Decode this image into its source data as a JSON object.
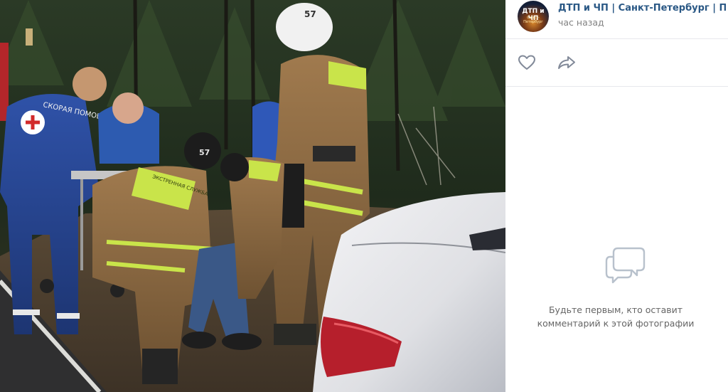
{
  "post": {
    "group_name": "ДТП и ЧП | Санкт-Петербург | Питер онлайн",
    "time": "час назад",
    "avatar_text": "ДТП и ЧП",
    "avatar_sub": "Санкт-Петербург"
  },
  "photo": {
    "helmet_number": "57",
    "uniform_text": "ЭКСТРЕННАЯ СЛУЖБА",
    "medic_text": "СКОРАЯ ПОМОЩЬ"
  },
  "actions": {
    "like_icon": "heart-outline",
    "share_icon": "share-arrow"
  },
  "comments": {
    "empty_icon": "speech-bubbles",
    "empty_line1": "Будьте первым, кто оставит",
    "empty_line2": "комментарий к этой фотографии"
  },
  "colors": {
    "link": "#2a5885",
    "muted": "#828282",
    "divider": "#e7e8ec",
    "icon": "#828a99"
  }
}
